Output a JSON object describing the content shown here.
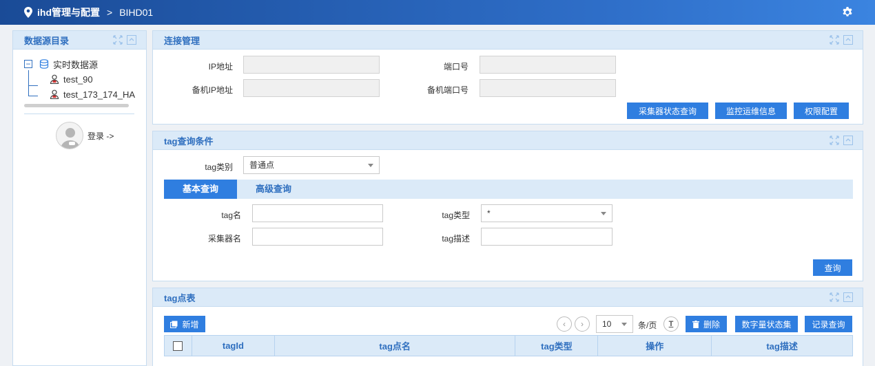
{
  "topbar": {
    "title": "ihd管理与配置",
    "separator": ">",
    "subtitle": "BIHD01"
  },
  "left": {
    "title": "数据源目录",
    "tree": {
      "root": "实时数据源",
      "children": [
        "test_90",
        "test_173_174_HA"
      ]
    },
    "login": "登录 ->"
  },
  "conn": {
    "title": "连接管理",
    "ip_label": "IP地址",
    "port_label": "端口号",
    "backup_ip_label": "备机IP地址",
    "backup_port_label": "备机端口号",
    "ip_value": "",
    "port_value": "",
    "backup_ip_value": "",
    "backup_port_value": "",
    "buttons": [
      "采集器状态查询",
      "监控运维信息",
      "权限配置"
    ]
  },
  "query": {
    "title": "tag查询条件",
    "tag_category_label": "tag类别",
    "tag_category_value": "普通点",
    "tabs": [
      "基本查询",
      "高级查询"
    ],
    "tag_name_label": "tag名",
    "tag_name_value": "",
    "tag_type_label": "tag类型",
    "tag_type_value": "*",
    "collector_label": "采集器名",
    "collector_value": "",
    "tag_desc_label": "tag描述",
    "tag_desc_value": "",
    "search_button": "查询"
  },
  "table": {
    "title": "tag点表",
    "add_button": "新增",
    "page_size": "10",
    "per_page_label": "条/页",
    "delete_button": "删除",
    "digital_state_button": "数字量状态集",
    "record_query_button": "记录查询",
    "columns": [
      "tagId",
      "tag点名",
      "tag类型",
      "操作",
      "tag描述"
    ]
  },
  "colors": {
    "accent": "#2f7ee0",
    "header_bg": "#dbeaf8",
    "title_text": "#2f6fbf"
  }
}
